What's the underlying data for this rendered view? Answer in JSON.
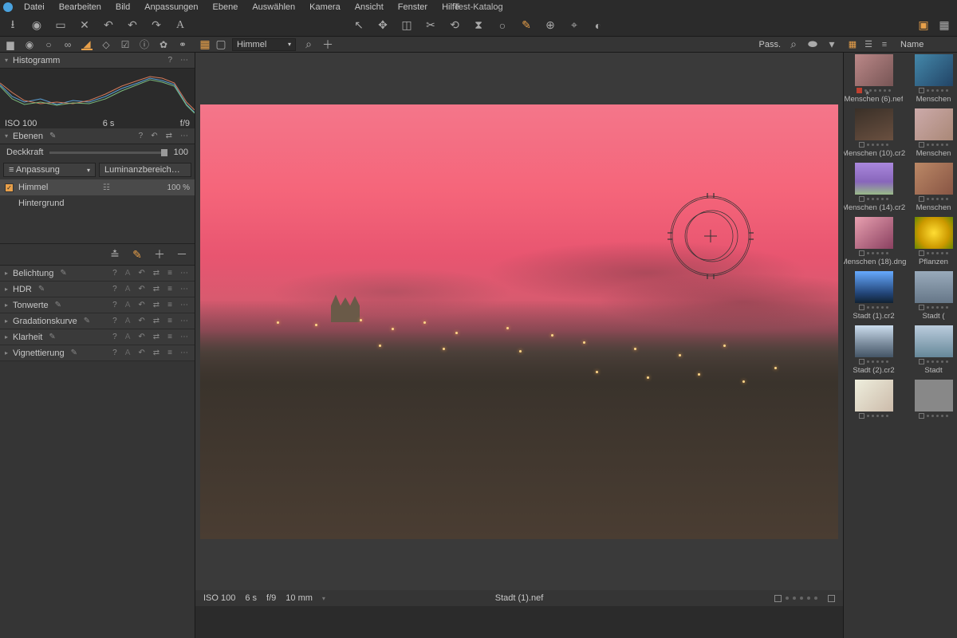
{
  "menubar": {
    "items": [
      "Datei",
      "Bearbeiten",
      "Bild",
      "Anpassungen",
      "Ebene",
      "Auswählen",
      "Kamera",
      "Ansicht",
      "Fenster",
      "Hilfe"
    ],
    "title": "Test-Katalog"
  },
  "left": {
    "histogram": {
      "title": "Histogramm",
      "iso": "ISO 100",
      "shutter": "6 s",
      "aperture": "f/9"
    },
    "layers": {
      "title": "Ebenen",
      "opacity_label": "Deckkraft",
      "opacity_value": "100",
      "mode_dd": "Anpassung",
      "lum_dd": "Luminanzbereich…",
      "items": [
        {
          "name": "Himmel",
          "pct": "100 %",
          "selected": true,
          "checked": true
        },
        {
          "name": "Hintergrund",
          "pct": "",
          "selected": false,
          "checked": false
        }
      ]
    },
    "adjustments": [
      {
        "name": "Belichtung"
      },
      {
        "name": "HDR"
      },
      {
        "name": "Tonwerte"
      },
      {
        "name": "Gradationskurve"
      },
      {
        "name": "Klarheit"
      },
      {
        "name": "Vignettierung"
      }
    ]
  },
  "center": {
    "layer_dd": "Himmel",
    "pass_label": "Pass.",
    "status": {
      "iso": "ISO 100",
      "shutter": "6 s",
      "aperture": "f/9",
      "focal": "10 mm",
      "filename": "Stadt (1).nef"
    }
  },
  "right": {
    "header": "Name",
    "thumbs": [
      {
        "label": "Menschen (6).nef",
        "bg": "linear-gradient(135deg,#b88,#755)",
        "flag": "red",
        "star": true
      },
      {
        "label": "Menschen",
        "bg": "linear-gradient(135deg,#48a,#246)"
      },
      {
        "label": "Menschen (10).cr2",
        "bg": "linear-gradient(160deg,#3a3028,#6a5040)"
      },
      {
        "label": "Menschen",
        "bg": "linear-gradient(135deg,#caa,#a87)"
      },
      {
        "label": "Menschen (14).cr2",
        "bg": "linear-gradient(to bottom,#a8d,#86b 60%,#9b8)"
      },
      {
        "label": "Menschen",
        "bg": "linear-gradient(135deg,#b86,#854)"
      },
      {
        "label": "Menschen (18).dng",
        "bg": "linear-gradient(140deg,#e8a0b0,#8a4060)"
      },
      {
        "label": "Pflanzen",
        "bg": "radial-gradient(circle,#fd3,#c90 60%,#680)"
      },
      {
        "label": "Stadt (1).cr2",
        "bg": "linear-gradient(to bottom,#6af,#247 70%,#123)"
      },
      {
        "label": "Stadt (",
        "bg": "linear-gradient(to bottom,#9ab,#678)"
      },
      {
        "label": "Stadt (2).cr2",
        "bg": "linear-gradient(to bottom,#cde,#789 60%,#456)"
      },
      {
        "label": "Stadt",
        "bg": "linear-gradient(to bottom,#bcd,#689)"
      },
      {
        "label": "",
        "bg": "linear-gradient(135deg,#eed,#cba)"
      },
      {
        "label": "",
        "bg": "#888"
      }
    ]
  }
}
